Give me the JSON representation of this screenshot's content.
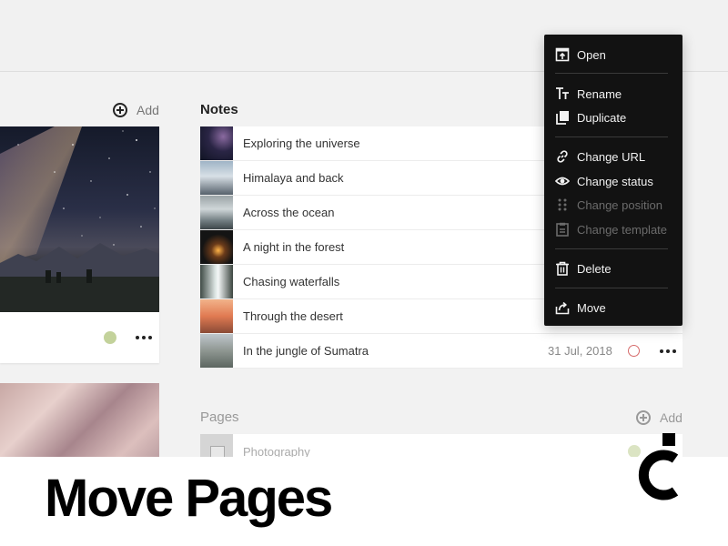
{
  "left_panel": {
    "add_label": "Add"
  },
  "notes": {
    "section_title": "Notes",
    "rows": [
      {
        "title": "Exploring the universe",
        "date": ""
      },
      {
        "title": "Himalaya and back",
        "date": ""
      },
      {
        "title": "Across the ocean",
        "date": ""
      },
      {
        "title": "A night in the forest",
        "date": ""
      },
      {
        "title": "Chasing waterfalls",
        "date": ""
      },
      {
        "title": "Through the desert",
        "date": ""
      },
      {
        "title": "In the jungle of Sumatra",
        "date": "31 Jul, 2018"
      }
    ]
  },
  "pages": {
    "section_title": "Pages",
    "add_label": "Add",
    "rows": [
      {
        "title": "Photography"
      }
    ]
  },
  "context_menu": {
    "items": [
      {
        "label": "Open",
        "icon": "open-icon",
        "enabled": true
      },
      {
        "label": "Rename",
        "icon": "text-icon",
        "enabled": true
      },
      {
        "label": "Duplicate",
        "icon": "duplicate-icon",
        "enabled": true
      },
      {
        "label": "Change URL",
        "icon": "link-icon",
        "enabled": true
      },
      {
        "label": "Change status",
        "icon": "eye-icon",
        "enabled": true
      },
      {
        "label": "Change position",
        "icon": "drag-handle-icon",
        "enabled": false
      },
      {
        "label": "Change template",
        "icon": "clipboard-icon",
        "enabled": false
      },
      {
        "label": "Delete",
        "icon": "trash-icon",
        "enabled": true
      },
      {
        "label": "Move",
        "icon": "move-icon",
        "enabled": true
      }
    ]
  },
  "banner": {
    "title": "Move Pages"
  },
  "colors": {
    "status_green": "#c3d29b",
    "status_red": "#d66a6a",
    "menu_background": "#121212"
  }
}
